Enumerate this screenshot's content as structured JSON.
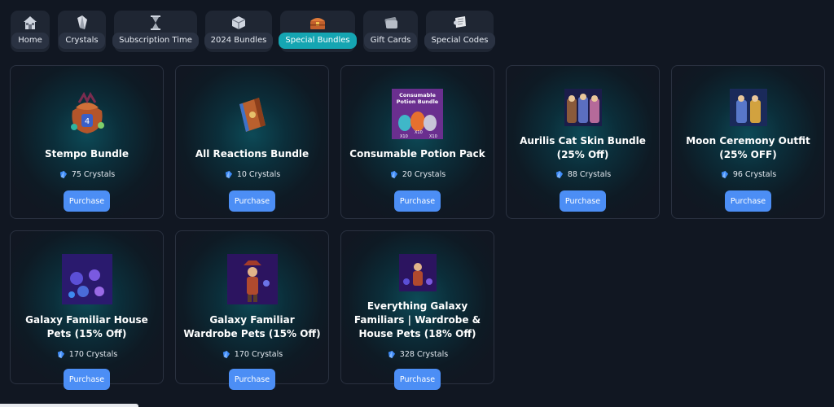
{
  "tabs": [
    {
      "label": "Home",
      "icon": "home-icon"
    },
    {
      "label": "Crystals",
      "icon": "crystal-icon"
    },
    {
      "label": "Subscription Time",
      "icon": "hourglass-icon"
    },
    {
      "label": "2024 Bundles",
      "icon": "box-icon"
    },
    {
      "label": "Special Bundles",
      "icon": "treasure-chest-icon",
      "active": true
    },
    {
      "label": "Gift Cards",
      "icon": "gift-card-icon"
    },
    {
      "label": "Special Codes",
      "icon": "scroll-icon"
    }
  ],
  "products": [
    {
      "title": "Stempo Bundle",
      "price": "75 Crystals",
      "button": "Purchase",
      "image": "stempo-bundle-image"
    },
    {
      "title": "All Reactions Bundle",
      "price": "10 Crystals",
      "button": "Purchase",
      "image": "reactions-bundle-image"
    },
    {
      "title": "Consumable Potion Pack",
      "price": "20 Crystals",
      "button": "Purchase",
      "image": "potion-bundle-image",
      "image_text": "Consumable Potion Bundle",
      "image_badges": [
        "X10",
        "X10",
        "X10"
      ]
    },
    {
      "title": "Aurilis Cat Skin Bundle (25% Off)",
      "price": "88 Crystals",
      "button": "Purchase",
      "image": "cat-skin-bundle-image"
    },
    {
      "title": "Moon Ceremony Outfit (25% OFF)",
      "price": "96 Crystals",
      "button": "Purchase",
      "image": "moon-outfit-image"
    },
    {
      "title": "Galaxy Familiar House Pets (15% Off)",
      "price": "170 Crystals",
      "button": "Purchase",
      "image": "galaxy-house-pets-image"
    },
    {
      "title": "Galaxy Familiar Wardrobe Pets (15% Off)",
      "price": "170 Crystals",
      "button": "Purchase",
      "image": "galaxy-wardrobe-pets-image"
    },
    {
      "title": "Everything Galaxy Familiars | Wardrobe & House Pets (18% Off)",
      "price": "328 Crystals",
      "button": "Purchase",
      "image": "everything-galaxy-image"
    }
  ],
  "colors": {
    "background": "#111722",
    "accent": "#15a5b2",
    "button": "#4c8ef5"
  }
}
